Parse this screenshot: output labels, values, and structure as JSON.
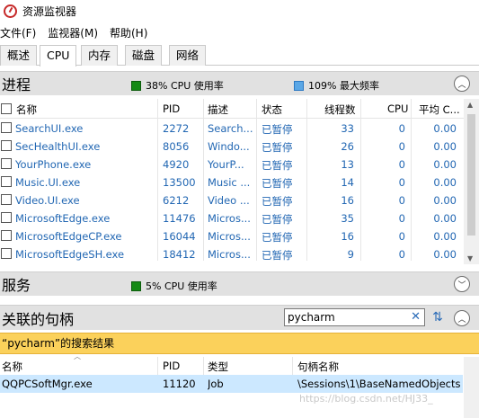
{
  "window": {
    "title": "资源监视器"
  },
  "menu": [
    "文件(F)",
    "监视器(M)",
    "帮助(H)"
  ],
  "tabs": [
    "概述",
    "CPU",
    "内存",
    "磁盘",
    "网络"
  ],
  "active_tab": "CPU",
  "processes": {
    "title": "进程",
    "cpu_usage": "38% CPU 使用率",
    "max_freq": "109% 最大频率",
    "columns": {
      "name": "名称",
      "pid": "PID",
      "desc": "描述",
      "status": "状态",
      "threads": "线程数",
      "cpu": "CPU",
      "avg": "平均 C..."
    },
    "rows": [
      {
        "name": "SearchUI.exe",
        "pid": "2272",
        "desc": "Search...",
        "status": "已暂停",
        "threads": "33",
        "cpu": "0",
        "avg": "0.00"
      },
      {
        "name": "SecHealthUI.exe",
        "pid": "8056",
        "desc": "Windo...",
        "status": "已暂停",
        "threads": "26",
        "cpu": "0",
        "avg": "0.00"
      },
      {
        "name": "YourPhone.exe",
        "pid": "4920",
        "desc": "YourP...",
        "status": "已暂停",
        "threads": "13",
        "cpu": "0",
        "avg": "0.00"
      },
      {
        "name": "Music.UI.exe",
        "pid": "13500",
        "desc": "Music ...",
        "status": "已暂停",
        "threads": "14",
        "cpu": "0",
        "avg": "0.00"
      },
      {
        "name": "Video.UI.exe",
        "pid": "6212",
        "desc": "Video ...",
        "status": "已暂停",
        "threads": "16",
        "cpu": "0",
        "avg": "0.00"
      },
      {
        "name": "MicrosoftEdge.exe",
        "pid": "11476",
        "desc": "Micros...",
        "status": "已暂停",
        "threads": "35",
        "cpu": "0",
        "avg": "0.00"
      },
      {
        "name": "MicrosoftEdgeCP.exe",
        "pid": "16044",
        "desc": "Micros...",
        "status": "已暂停",
        "threads": "16",
        "cpu": "0",
        "avg": "0.00"
      },
      {
        "name": "MicrosoftEdgeSH.exe",
        "pid": "18412",
        "desc": "Micros...",
        "status": "已暂停",
        "threads": "9",
        "cpu": "0",
        "avg": "0.00"
      }
    ]
  },
  "services": {
    "title": "服务",
    "cpu_usage": "5% CPU 使用率"
  },
  "handles": {
    "title": "关联的句柄",
    "search_value": "pycharm",
    "result_banner": "“pycharm”的搜索结果",
    "columns": {
      "name": "名称",
      "pid": "PID",
      "type": "类型",
      "handle": "句柄名称"
    },
    "rows": [
      {
        "name": "QQPCSoftMgr.exe",
        "pid": "11120",
        "type": "Job",
        "handle": "\\Sessions\\1\\BaseNamedObjects..."
      }
    ]
  },
  "watermark": "https://blog.csdn.net/HJ33_"
}
